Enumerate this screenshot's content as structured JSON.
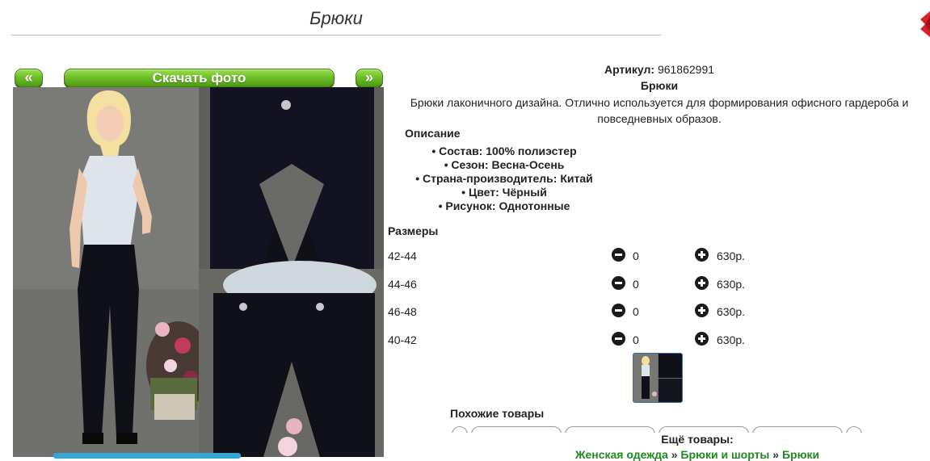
{
  "page": {
    "title": "Брюки"
  },
  "gallery": {
    "prev_label": "«",
    "download_label": "Скачать фото",
    "next_label": "»"
  },
  "product": {
    "article_label": "Артикул:",
    "article_value": "961862991",
    "name": "Брюки",
    "description": "Брюки лаконичного дизайна. Отлично используется для формирования офисного гардероба и повседневных образов.",
    "description_heading": "Описание",
    "properties": [
      "Состав: 100% полиэстер",
      "Сезон: Весна-Осень",
      "Страна-производитель: Китай",
      "Цвет: Чёрный",
      "Рисунок: Однотонные"
    ]
  },
  "sizes": {
    "heading": "Размеры",
    "rows": [
      {
        "size": "42-44",
        "qty": "0",
        "price": "630р."
      },
      {
        "size": "44-46",
        "qty": "0",
        "price": "630р."
      },
      {
        "size": "46-48",
        "qty": "0",
        "price": "630р."
      },
      {
        "size": "40-42",
        "qty": "0",
        "price": "630р."
      }
    ]
  },
  "similar": {
    "heading": "Похожие товары"
  },
  "more": {
    "heading": "Ещё товары:",
    "crumbs": [
      "Женская одежда",
      "Брюки и шорты",
      "Брюки"
    ],
    "separator": "»"
  },
  "colors": {
    "accent_green": "#6fbf2a",
    "link_green": "#1f8a1f",
    "corner_red": "#d9232a"
  }
}
